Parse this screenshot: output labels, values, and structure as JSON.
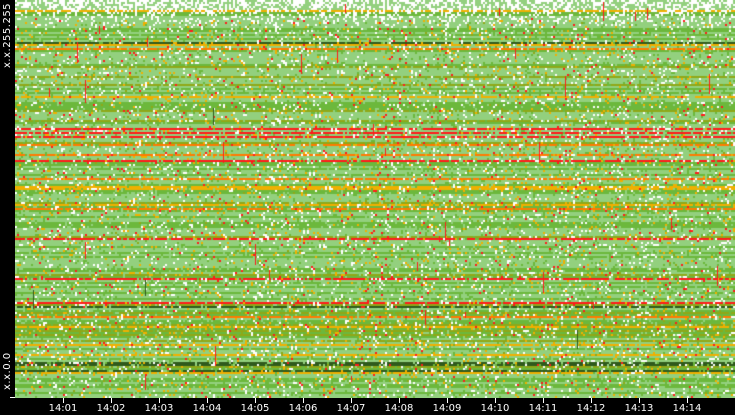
{
  "chart_data": {
    "type": "heatmap",
    "title": "",
    "xlabel": "",
    "ylabel": "",
    "y_tick_labels": [
      "x.x.255.255",
      "x.x.0.0"
    ],
    "x_tick_labels": [
      "14:01",
      "14:02",
      "14:03",
      "14:04",
      "14:05",
      "14:06",
      "14:07",
      "14:08",
      "14:09",
      "14:10",
      "14:11",
      "14:12",
      "14:13",
      "14:14"
    ],
    "xlim_minutes": [
      0,
      15
    ],
    "x_start": "14:00",
    "x_end": "14:15",
    "color_scale": [
      "#ffffff",
      "#93d07e",
      "#6cb83c",
      "#8fa818",
      "#f0b000",
      "#ff7a00",
      "#ff1a1a",
      "#2f5a1c"
    ],
    "grid": false,
    "legend": "none"
  }
}
